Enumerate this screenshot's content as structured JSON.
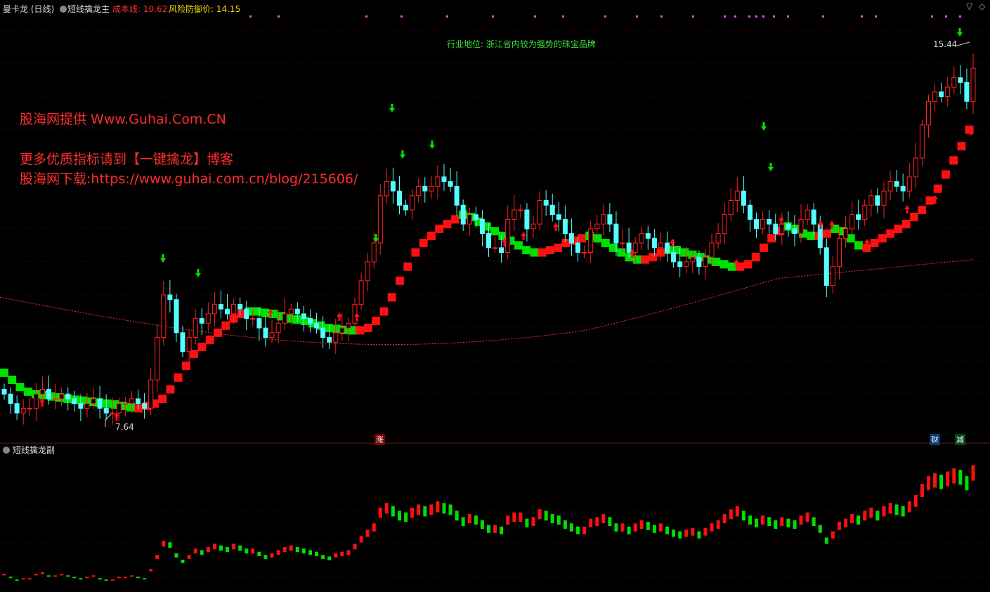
{
  "header": {
    "symbol": "曼卡龙 (日线)",
    "indicator": "短线擒龙主",
    "cost_label": "成本线: 10.62",
    "risk_label": "风险防御价: 14.15",
    "colors": {
      "symbol": "#dcdcdc",
      "indicator": "#dcdcdc",
      "cost": "#ff3030",
      "risk": "#ffd700"
    }
  },
  "watermark": {
    "line1": "股海网提供 Www.Guhai.Com.CN",
    "line2": "更多优质指标请到【一键擒龙】博客",
    "line3": "股海网下载:https://www.guhai.com.cn/blog/215606/"
  },
  "annotation": "行业地位: 浙江省内较为强势的珠宝品牌",
  "price_labels": {
    "low": "7.64",
    "high": "15.44"
  },
  "markers": {
    "zhang": "涨",
    "cai": "财",
    "jian": "减"
  },
  "sub_panel": {
    "title": "短线擒龙副"
  },
  "colors": {
    "up": "#ff2020",
    "down": "#54ffff",
    "green": "#00e000",
    "red": "#ff1010",
    "ma": "#ff3030"
  },
  "chart_data": {
    "type": "candlestick",
    "price_range": [
      7.2,
      15.9
    ],
    "open": [
      8.1,
      8.0,
      7.8,
      7.6,
      7.7,
      7.7,
      8.0,
      8.1,
      7.9,
      7.9,
      8.0,
      7.9,
      7.8,
      7.7,
      7.8,
      7.9,
      7.7,
      7.6,
      7.6,
      7.8,
      7.8,
      7.9,
      7.8,
      7.7,
      8.3,
      9.2,
      10.1,
      10.0,
      9.3,
      8.9,
      9.2,
      9.6,
      9.5,
      9.7,
      9.9,
      9.8,
      9.7,
      9.9,
      9.8,
      9.6,
      9.6,
      9.4,
      9.2,
      9.3,
      9.5,
      9.7,
      9.8,
      9.7,
      9.6,
      9.5,
      9.4,
      9.2,
      9.1,
      9.3,
      9.4,
      9.5,
      9.9,
      10.4,
      10.8,
      11.2,
      12.2,
      12.5,
      12.3,
      12.0,
      11.9,
      12.2,
      12.4,
      12.3,
      12.4,
      12.6,
      12.5,
      12.4,
      12.0,
      11.6,
      11.8,
      11.7,
      11.4,
      11.1,
      11.1,
      11.0,
      11.7,
      11.9,
      11.9,
      11.5,
      11.6,
      12.1,
      12.0,
      11.8,
      11.7,
      11.4,
      11.2,
      11.0,
      11.0,
      11.5,
      11.6,
      11.8,
      11.6,
      11.2,
      11.2,
      11.0,
      11.2,
      11.4,
      11.3,
      11.1,
      11.2,
      11.0,
      10.8,
      10.7,
      10.8,
      10.9,
      10.7,
      10.9,
      11.2,
      11.4,
      11.8,
      12.1,
      12.3,
      12.0,
      11.7,
      11.5,
      11.7,
      11.6,
      11.4,
      11.6,
      11.5,
      11.4,
      11.7,
      11.9,
      11.6,
      11.1,
      10.3,
      10.7,
      11.3,
      11.5,
      11.8,
      11.7,
      12.0,
      12.2,
      12.0,
      12.3,
      12.5,
      12.4,
      12.3,
      12.6,
      13.0,
      13.7,
      14.2,
      14.4,
      14.3,
      14.5,
      14.7,
      14.6,
      14.2
    ],
    "close": [
      8.0,
      7.8,
      7.6,
      7.7,
      7.7,
      8.0,
      8.1,
      7.9,
      7.9,
      8.0,
      7.9,
      7.8,
      7.7,
      7.8,
      7.9,
      7.7,
      7.6,
      7.6,
      7.8,
      7.8,
      7.9,
      7.8,
      7.7,
      8.3,
      9.2,
      10.1,
      10.0,
      9.3,
      8.9,
      9.2,
      9.6,
      9.5,
      9.7,
      9.9,
      9.8,
      9.7,
      9.9,
      9.8,
      9.6,
      9.6,
      9.4,
      9.2,
      9.3,
      9.5,
      9.7,
      9.8,
      9.7,
      9.6,
      9.5,
      9.4,
      9.2,
      9.1,
      9.3,
      9.4,
      9.5,
      9.9,
      10.4,
      10.8,
      11.2,
      12.2,
      12.5,
      12.3,
      12.0,
      11.9,
      12.2,
      12.4,
      12.3,
      12.4,
      12.6,
      12.5,
      12.4,
      12.0,
      11.6,
      11.8,
      11.7,
      11.4,
      11.1,
      11.1,
      11.0,
      11.7,
      11.9,
      11.9,
      11.5,
      11.6,
      12.1,
      12.0,
      11.8,
      11.7,
      11.4,
      11.2,
      11.0,
      11.0,
      11.5,
      11.6,
      11.8,
      11.6,
      11.2,
      11.2,
      11.0,
      11.2,
      11.4,
      11.3,
      11.1,
      11.2,
      11.0,
      10.8,
      10.7,
      10.8,
      10.9,
      10.7,
      10.9,
      11.2,
      11.4,
      11.8,
      12.1,
      12.3,
      12.0,
      11.7,
      11.5,
      11.7,
      11.6,
      11.4,
      11.6,
      11.5,
      11.4,
      11.7,
      11.9,
      11.6,
      11.1,
      10.3,
      10.7,
      11.3,
      11.5,
      11.8,
      11.7,
      12.0,
      12.2,
      12.0,
      12.3,
      12.5,
      12.4,
      12.3,
      12.6,
      13.0,
      13.7,
      14.2,
      14.4,
      14.3,
      14.5,
      14.7,
      14.6,
      14.2,
      14.9
    ],
    "support_line": [
      8.45,
      8.3,
      8.15,
      8.05,
      8.0,
      7.98,
      7.95,
      7.93,
      7.9,
      7.88,
      7.86,
      7.84,
      7.82,
      7.8,
      7.78,
      7.75,
      7.72,
      7.7,
      7.75,
      7.8,
      7.9,
      8.1,
      8.35,
      8.6,
      8.85,
      9.0,
      9.15,
      9.3,
      9.45,
      9.6,
      9.7,
      9.75,
      9.75,
      9.72,
      9.7,
      9.65,
      9.6,
      9.58,
      9.55,
      9.5,
      9.45,
      9.4,
      9.38,
      9.36,
      9.35,
      9.35,
      9.4,
      9.55,
      9.75,
      10.05,
      10.4,
      10.7,
      11.0,
      11.2,
      11.35,
      11.5,
      11.6,
      11.7,
      11.8,
      11.75,
      11.65,
      11.55,
      11.45,
      11.35,
      11.25,
      11.15,
      11.05,
      11.0,
      11.0,
      11.05,
      11.1,
      11.2,
      11.25,
      11.3,
      11.35,
      11.3,
      11.2,
      11.1,
      11.0,
      10.9,
      10.85,
      10.85,
      10.9,
      11.0,
      11.05,
      11.05,
      11.0,
      10.95,
      10.9,
      10.85,
      10.8,
      10.75,
      10.7,
      10.7,
      10.75,
      10.9,
      11.1,
      11.3,
      11.45,
      11.55,
      11.5,
      11.4,
      11.35,
      11.35,
      11.4,
      11.5,
      11.45,
      11.3,
      11.15,
      11.1,
      11.2,
      11.3,
      11.4,
      11.5,
      11.6,
      11.75,
      11.9,
      12.1,
      12.35,
      12.65,
      12.95,
      13.25,
      13.6,
      13.9
    ],
    "ma_line": [
      10.1,
      9.2,
      9.3,
      9.7,
      10.2
    ],
    "ma_range": [
      10.1,
      10.2
    ]
  }
}
